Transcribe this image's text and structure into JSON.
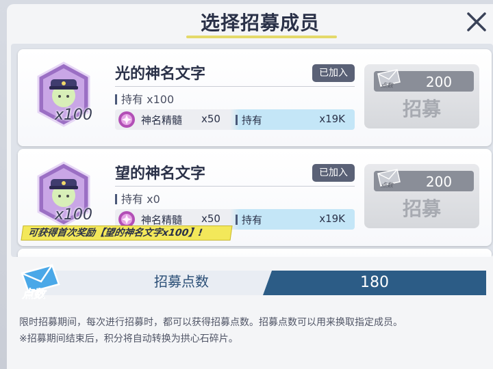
{
  "dialog": {
    "title": "选择招募成员"
  },
  "cards": [
    {
      "name": "光的神名文字",
      "portrait_qty": "x100",
      "badge": "已加入",
      "owned_label": "持有",
      "owned_value": "x100",
      "material_name": "神名精髓",
      "material_cost": "x50",
      "material_owned_label": "持有",
      "material_owned_value": "x19K",
      "cost_icon_text": "点数",
      "cost": "200",
      "button_label": "招募"
    },
    {
      "name": "望的神名文字",
      "portrait_qty": "x100",
      "badge": "已加入",
      "owned_label": "持有",
      "owned_value": "x0",
      "material_name": "神名精髓",
      "material_cost": "x50",
      "material_owned_label": "持有",
      "material_owned_value": "x19K",
      "cost_icon_text": "点数",
      "cost": "200",
      "button_label": "招募",
      "reward_banner": "可获得首次奖励【望的神名文字x100】!"
    }
  ],
  "points": {
    "icon_text": "点数",
    "label": "招募点数",
    "value": "180"
  },
  "description": {
    "line1": "限时招募期间，每次进行招募时，都可以获得招募点数。招募点数可以用来换取指定成员。",
    "line2": "※招募期间结束后，积分将自动转换为拱心石碎片。"
  },
  "colors": {
    "accent_blue": "#2c5c86",
    "banner_yellow": "#f3e85a",
    "badge_gray": "#5a6176"
  }
}
